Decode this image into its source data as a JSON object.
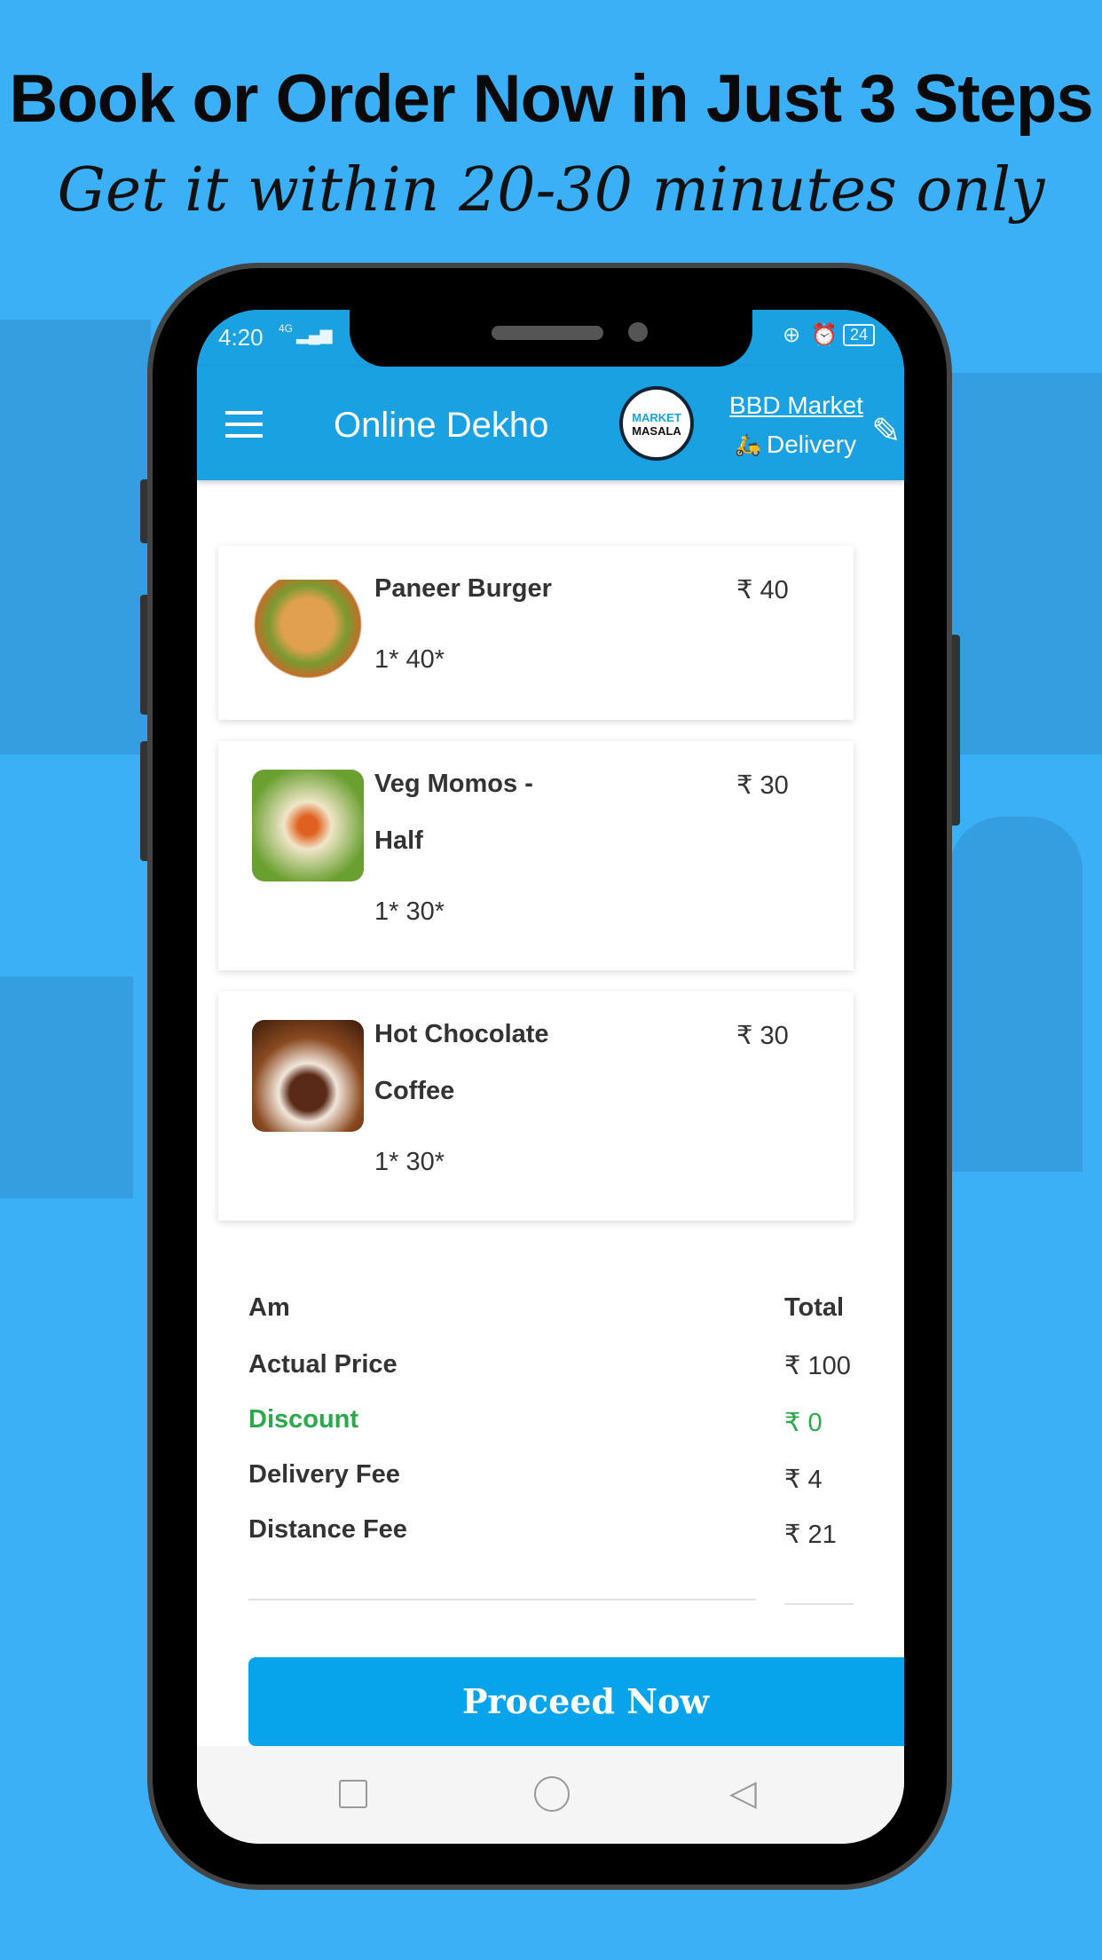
{
  "promo": {
    "headline": "Book or Order Now in Just 3 Steps",
    "subheadline": "Get it within 20-30 minutes only"
  },
  "status_bar": {
    "time": "4:20",
    "network": "4G",
    "battery": "24"
  },
  "app_bar": {
    "title": "Online Dekho",
    "logo_text_1": "MARKET",
    "logo_text_2": "MASALA",
    "location": "BBD Market",
    "mode": "Delivery"
  },
  "cart": [
    {
      "name": "Paneer Burger",
      "qty": "1* 40*",
      "price": "₹ 40"
    },
    {
      "name": "Veg Momos - Half",
      "qty": "1* 30*",
      "price": "₹ 30"
    },
    {
      "name": "Hot Chocolate Coffee",
      "qty": "1* 30*",
      "price": "₹ 30"
    }
  ],
  "summary": {
    "header_left": "Am",
    "header_right": "Total",
    "rows": [
      {
        "label": "Actual Price",
        "value": "₹ 100"
      },
      {
        "label": "Discount",
        "value": "₹ 0"
      },
      {
        "label": "Delivery Fee",
        "value": "₹ 4"
      },
      {
        "label": "Distance Fee",
        "value": "₹ 21"
      }
    ]
  },
  "proceed_label": "Proceed Now",
  "colors": {
    "background": "#3cb0f7",
    "app_bar": "#1aa1e1",
    "button": "#07a4ec",
    "discount": "#2aa84a"
  }
}
